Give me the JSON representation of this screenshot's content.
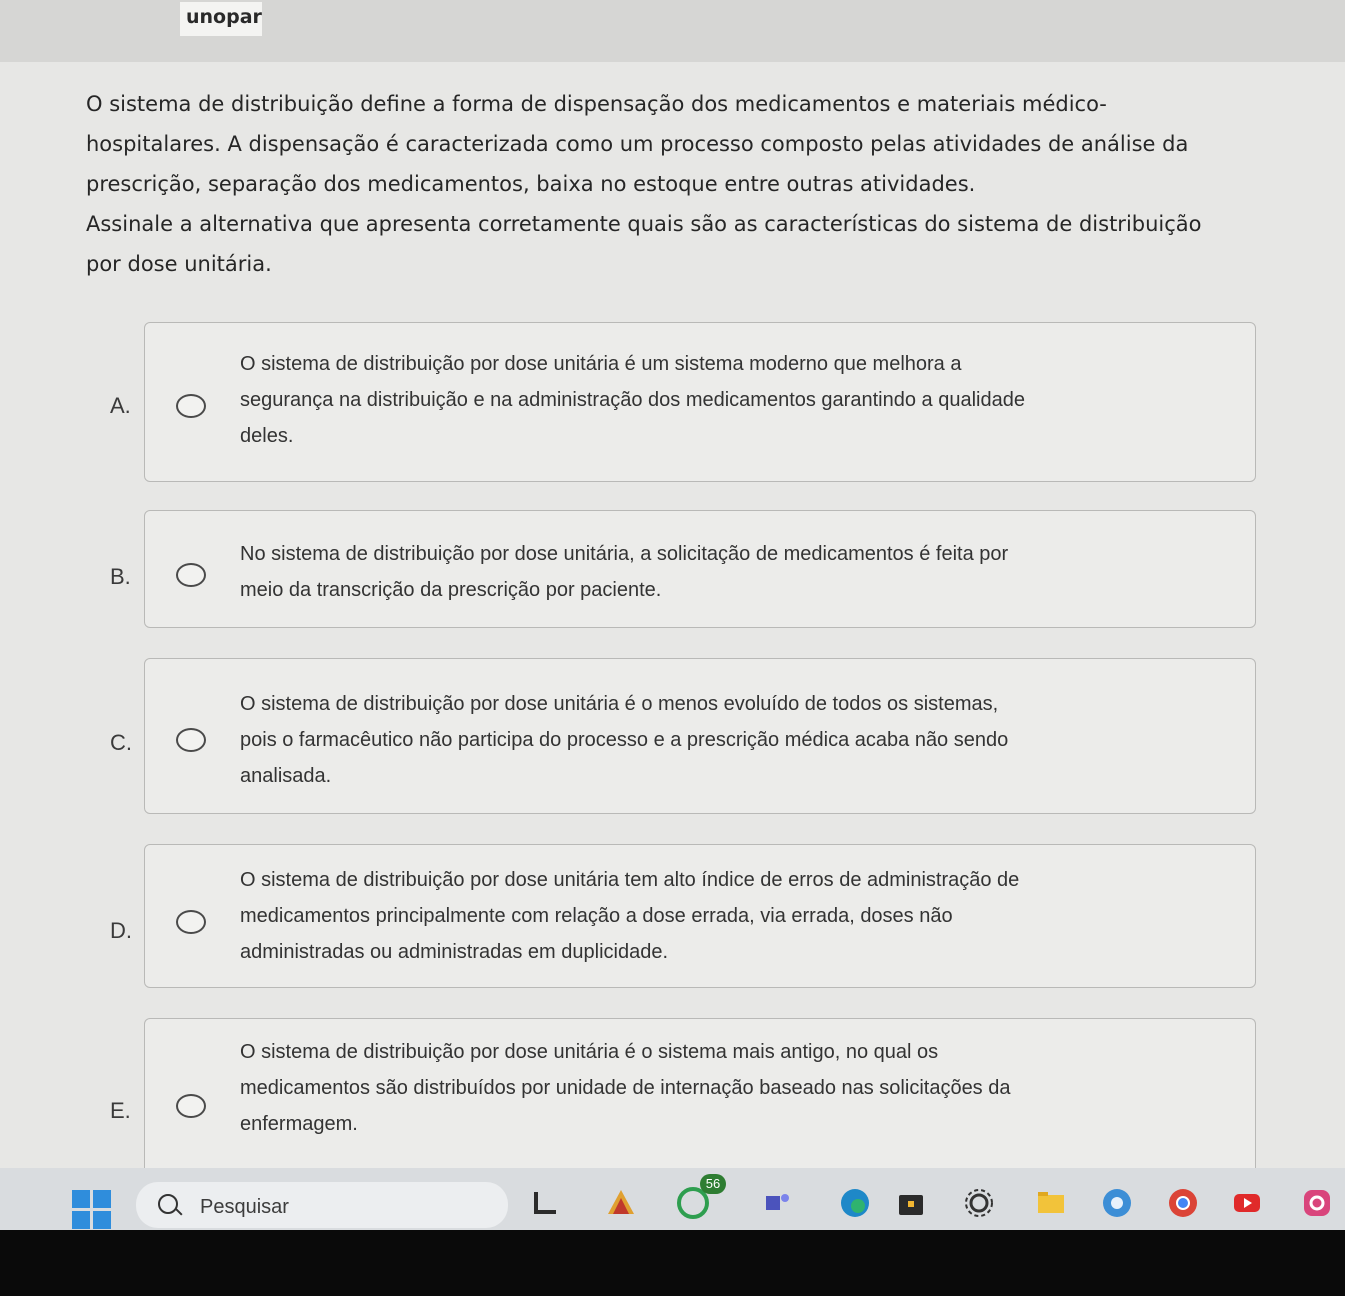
{
  "header": {
    "brand": "unopar"
  },
  "question": {
    "lines": [
      "O sistema de distribuição define a forma de dispensação dos medicamentos e materiais médico-",
      "hospitalares. A dispensação é caracterizada como um processo composto pelas atividades de análise da",
      "prescrição, separação dos medicamentos, baixa no estoque entre outras atividades.",
      "Assinale a alternativa que apresenta corretamente quais são as características do sistema de distribuição",
      "por dose unitária."
    ]
  },
  "options": [
    {
      "letter": "A.",
      "lines": [
        "O sistema de distribuição por dose unitária é um sistema moderno que melhora a",
        "segurança na distribuição e na administração dos medicamentos garantindo a qualidade",
        "deles."
      ]
    },
    {
      "letter": "B.",
      "lines": [
        "No sistema de distribuição por dose unitária, a solicitação de medicamentos é feita por",
        "meio da transcrição da prescrição por paciente."
      ]
    },
    {
      "letter": "C.",
      "lines": [
        "O sistema de distribuição por dose unitária é o menos evoluído de todos os sistemas,",
        "pois o farmacêutico não participa do processo e a prescrição médica acaba não sendo",
        "analisada."
      ]
    },
    {
      "letter": "D.",
      "lines": [
        "O sistema de distribuição por dose unitária tem alto índice de erros de administração de",
        "medicamentos principalmente com relação a dose errada, via errada, doses não",
        "administradas ou administradas em duplicidade."
      ]
    },
    {
      "letter": "E.",
      "lines": [
        "O sistema de distribuição por dose unitária é o sistema mais antigo, no qual os",
        "medicamentos são distribuídos por unidade de internação baseado nas solicitações da",
        "enfermagem."
      ]
    }
  ],
  "taskbar": {
    "search_label": "Pesquisar",
    "badge_count": "56",
    "icons": [
      "windows-start-icon",
      "search-icon",
      "task-view-icon",
      "app-icon",
      "whatsapp-icon",
      "teams-icon",
      "edge-icon",
      "store-icon",
      "settings-icon",
      "file-explorer-icon",
      "google-icon",
      "chrome-icon",
      "youtube-icon",
      "instagram-icon"
    ]
  }
}
